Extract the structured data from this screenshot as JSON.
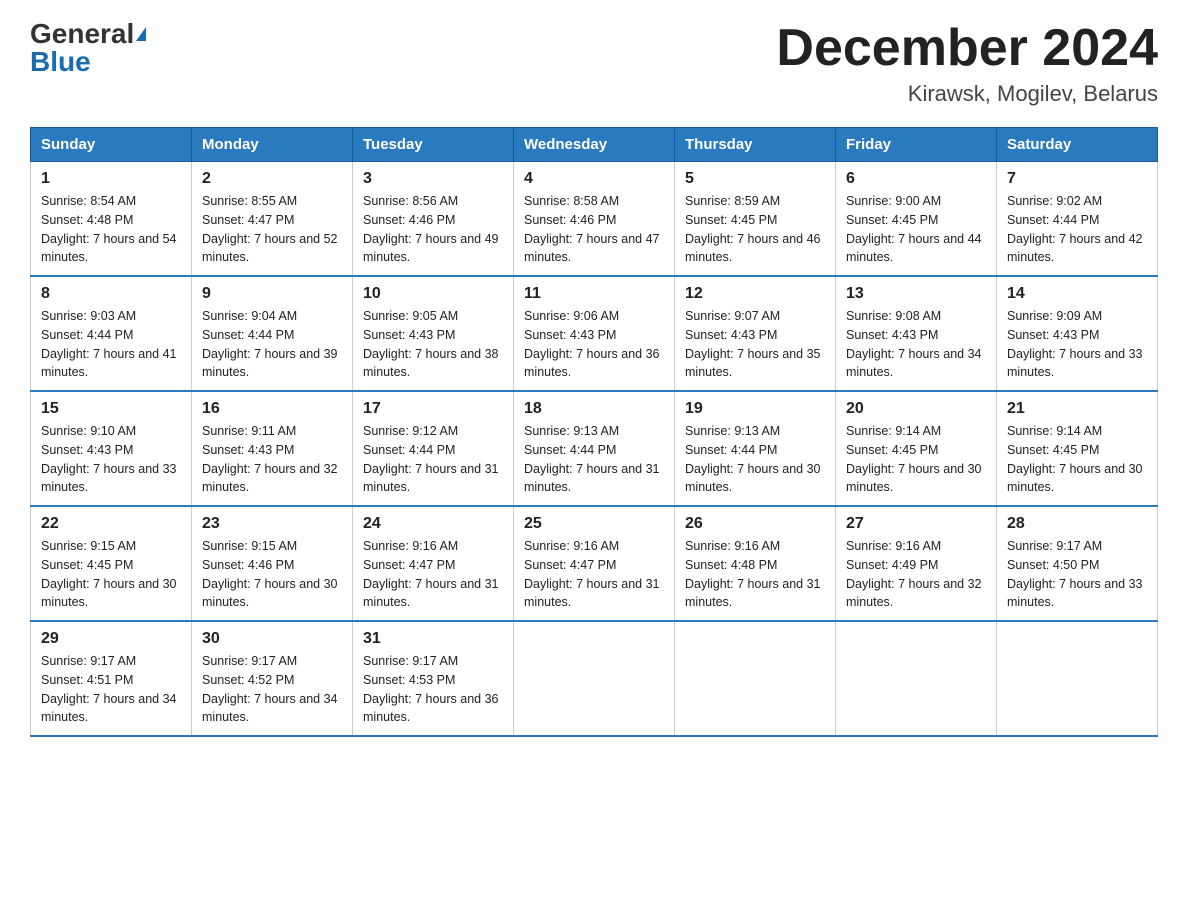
{
  "header": {
    "logo_general": "General",
    "logo_blue": "Blue",
    "month_title": "December 2024",
    "location": "Kirawsk, Mogilev, Belarus"
  },
  "days_of_week": [
    "Sunday",
    "Monday",
    "Tuesday",
    "Wednesday",
    "Thursday",
    "Friday",
    "Saturday"
  ],
  "weeks": [
    [
      {
        "day": "1",
        "sunrise": "8:54 AM",
        "sunset": "4:48 PM",
        "daylight": "7 hours and 54 minutes."
      },
      {
        "day": "2",
        "sunrise": "8:55 AM",
        "sunset": "4:47 PM",
        "daylight": "7 hours and 52 minutes."
      },
      {
        "day": "3",
        "sunrise": "8:56 AM",
        "sunset": "4:46 PM",
        "daylight": "7 hours and 49 minutes."
      },
      {
        "day": "4",
        "sunrise": "8:58 AM",
        "sunset": "4:46 PM",
        "daylight": "7 hours and 47 minutes."
      },
      {
        "day": "5",
        "sunrise": "8:59 AM",
        "sunset": "4:45 PM",
        "daylight": "7 hours and 46 minutes."
      },
      {
        "day": "6",
        "sunrise": "9:00 AM",
        "sunset": "4:45 PM",
        "daylight": "7 hours and 44 minutes."
      },
      {
        "day": "7",
        "sunrise": "9:02 AM",
        "sunset": "4:44 PM",
        "daylight": "7 hours and 42 minutes."
      }
    ],
    [
      {
        "day": "8",
        "sunrise": "9:03 AM",
        "sunset": "4:44 PM",
        "daylight": "7 hours and 41 minutes."
      },
      {
        "day": "9",
        "sunrise": "9:04 AM",
        "sunset": "4:44 PM",
        "daylight": "7 hours and 39 minutes."
      },
      {
        "day": "10",
        "sunrise": "9:05 AM",
        "sunset": "4:43 PM",
        "daylight": "7 hours and 38 minutes."
      },
      {
        "day": "11",
        "sunrise": "9:06 AM",
        "sunset": "4:43 PM",
        "daylight": "7 hours and 36 minutes."
      },
      {
        "day": "12",
        "sunrise": "9:07 AM",
        "sunset": "4:43 PM",
        "daylight": "7 hours and 35 minutes."
      },
      {
        "day": "13",
        "sunrise": "9:08 AM",
        "sunset": "4:43 PM",
        "daylight": "7 hours and 34 minutes."
      },
      {
        "day": "14",
        "sunrise": "9:09 AM",
        "sunset": "4:43 PM",
        "daylight": "7 hours and 33 minutes."
      }
    ],
    [
      {
        "day": "15",
        "sunrise": "9:10 AM",
        "sunset": "4:43 PM",
        "daylight": "7 hours and 33 minutes."
      },
      {
        "day": "16",
        "sunrise": "9:11 AM",
        "sunset": "4:43 PM",
        "daylight": "7 hours and 32 minutes."
      },
      {
        "day": "17",
        "sunrise": "9:12 AM",
        "sunset": "4:44 PM",
        "daylight": "7 hours and 31 minutes."
      },
      {
        "day": "18",
        "sunrise": "9:13 AM",
        "sunset": "4:44 PM",
        "daylight": "7 hours and 31 minutes."
      },
      {
        "day": "19",
        "sunrise": "9:13 AM",
        "sunset": "4:44 PM",
        "daylight": "7 hours and 30 minutes."
      },
      {
        "day": "20",
        "sunrise": "9:14 AM",
        "sunset": "4:45 PM",
        "daylight": "7 hours and 30 minutes."
      },
      {
        "day": "21",
        "sunrise": "9:14 AM",
        "sunset": "4:45 PM",
        "daylight": "7 hours and 30 minutes."
      }
    ],
    [
      {
        "day": "22",
        "sunrise": "9:15 AM",
        "sunset": "4:45 PM",
        "daylight": "7 hours and 30 minutes."
      },
      {
        "day": "23",
        "sunrise": "9:15 AM",
        "sunset": "4:46 PM",
        "daylight": "7 hours and 30 minutes."
      },
      {
        "day": "24",
        "sunrise": "9:16 AM",
        "sunset": "4:47 PM",
        "daylight": "7 hours and 31 minutes."
      },
      {
        "day": "25",
        "sunrise": "9:16 AM",
        "sunset": "4:47 PM",
        "daylight": "7 hours and 31 minutes."
      },
      {
        "day": "26",
        "sunrise": "9:16 AM",
        "sunset": "4:48 PM",
        "daylight": "7 hours and 31 minutes."
      },
      {
        "day": "27",
        "sunrise": "9:16 AM",
        "sunset": "4:49 PM",
        "daylight": "7 hours and 32 minutes."
      },
      {
        "day": "28",
        "sunrise": "9:17 AM",
        "sunset": "4:50 PM",
        "daylight": "7 hours and 33 minutes."
      }
    ],
    [
      {
        "day": "29",
        "sunrise": "9:17 AM",
        "sunset": "4:51 PM",
        "daylight": "7 hours and 34 minutes."
      },
      {
        "day": "30",
        "sunrise": "9:17 AM",
        "sunset": "4:52 PM",
        "daylight": "7 hours and 34 minutes."
      },
      {
        "day": "31",
        "sunrise": "9:17 AM",
        "sunset": "4:53 PM",
        "daylight": "7 hours and 36 minutes."
      },
      null,
      null,
      null,
      null
    ]
  ]
}
